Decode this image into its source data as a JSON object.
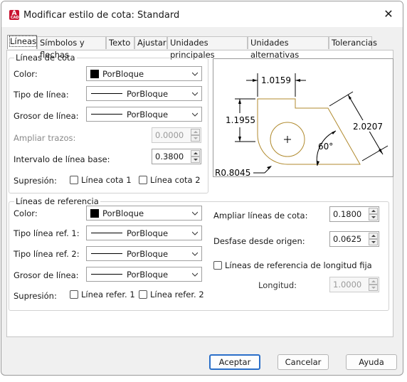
{
  "window": {
    "title": "Modificar estilo de cota: Standard",
    "icon_letter": "A",
    "icon_sub": "CAD"
  },
  "tabs": [
    "Líneas",
    "Símbolos y flechas",
    "Texto",
    "Ajustar",
    "Unidades principales",
    "Unidades alternativas",
    "Tolerancias"
  ],
  "dim_lines": {
    "legend": "Líneas de cota",
    "color_label": "Color:",
    "color_value": "PorBloque",
    "linetype_label": "Tipo de línea:",
    "linetype_value": "PorBloque",
    "lineweight_label": "Grosor de línea:",
    "lineweight_value": "PorBloque",
    "extend_label": "Ampliar trazos:",
    "extend_value": "0.0000",
    "baseline_label": "Intervalo de línea base:",
    "baseline_value": "0.3800",
    "suppress_label": "Supresión:",
    "suppress_1": "Línea cota 1",
    "suppress_2": "Línea cota 2"
  },
  "ext_lines": {
    "legend": "Líneas de referencia",
    "color_label": "Color:",
    "color_value": "PorBloque",
    "linetype1_label": "Tipo línea ref. 1:",
    "linetype1_value": "PorBloque",
    "linetype2_label": "Tipo línea ref. 2:",
    "linetype2_value": "PorBloque",
    "lineweight_label": "Grosor de línea:",
    "lineweight_value": "PorBloque",
    "suppress_label": "Supresión:",
    "suppress_1": "Línea refer. 1",
    "suppress_2": "Línea refer. 2",
    "extend_beyond_label": "Ampliar líneas de cota:",
    "extend_beyond_value": "0.1800",
    "offset_label": "Desfase desde origen:",
    "offset_value": "0.0625",
    "fixed_length_label": "Líneas de referencia de longitud fija",
    "length_label": "Longitud:",
    "length_value": "1.0000"
  },
  "preview": {
    "dim_top": "1.0159",
    "dim_left": "1.1955",
    "dim_aligned": "2.0207",
    "angle": "60°",
    "radius": "R0.8045"
  },
  "buttons": {
    "ok": "Aceptar",
    "cancel": "Cancelar",
    "help": "Ayuda"
  },
  "colors": {
    "accent": "#2a6fc9",
    "app_icon": "#c8102e",
    "preview_geometry": "#b08a2e"
  }
}
